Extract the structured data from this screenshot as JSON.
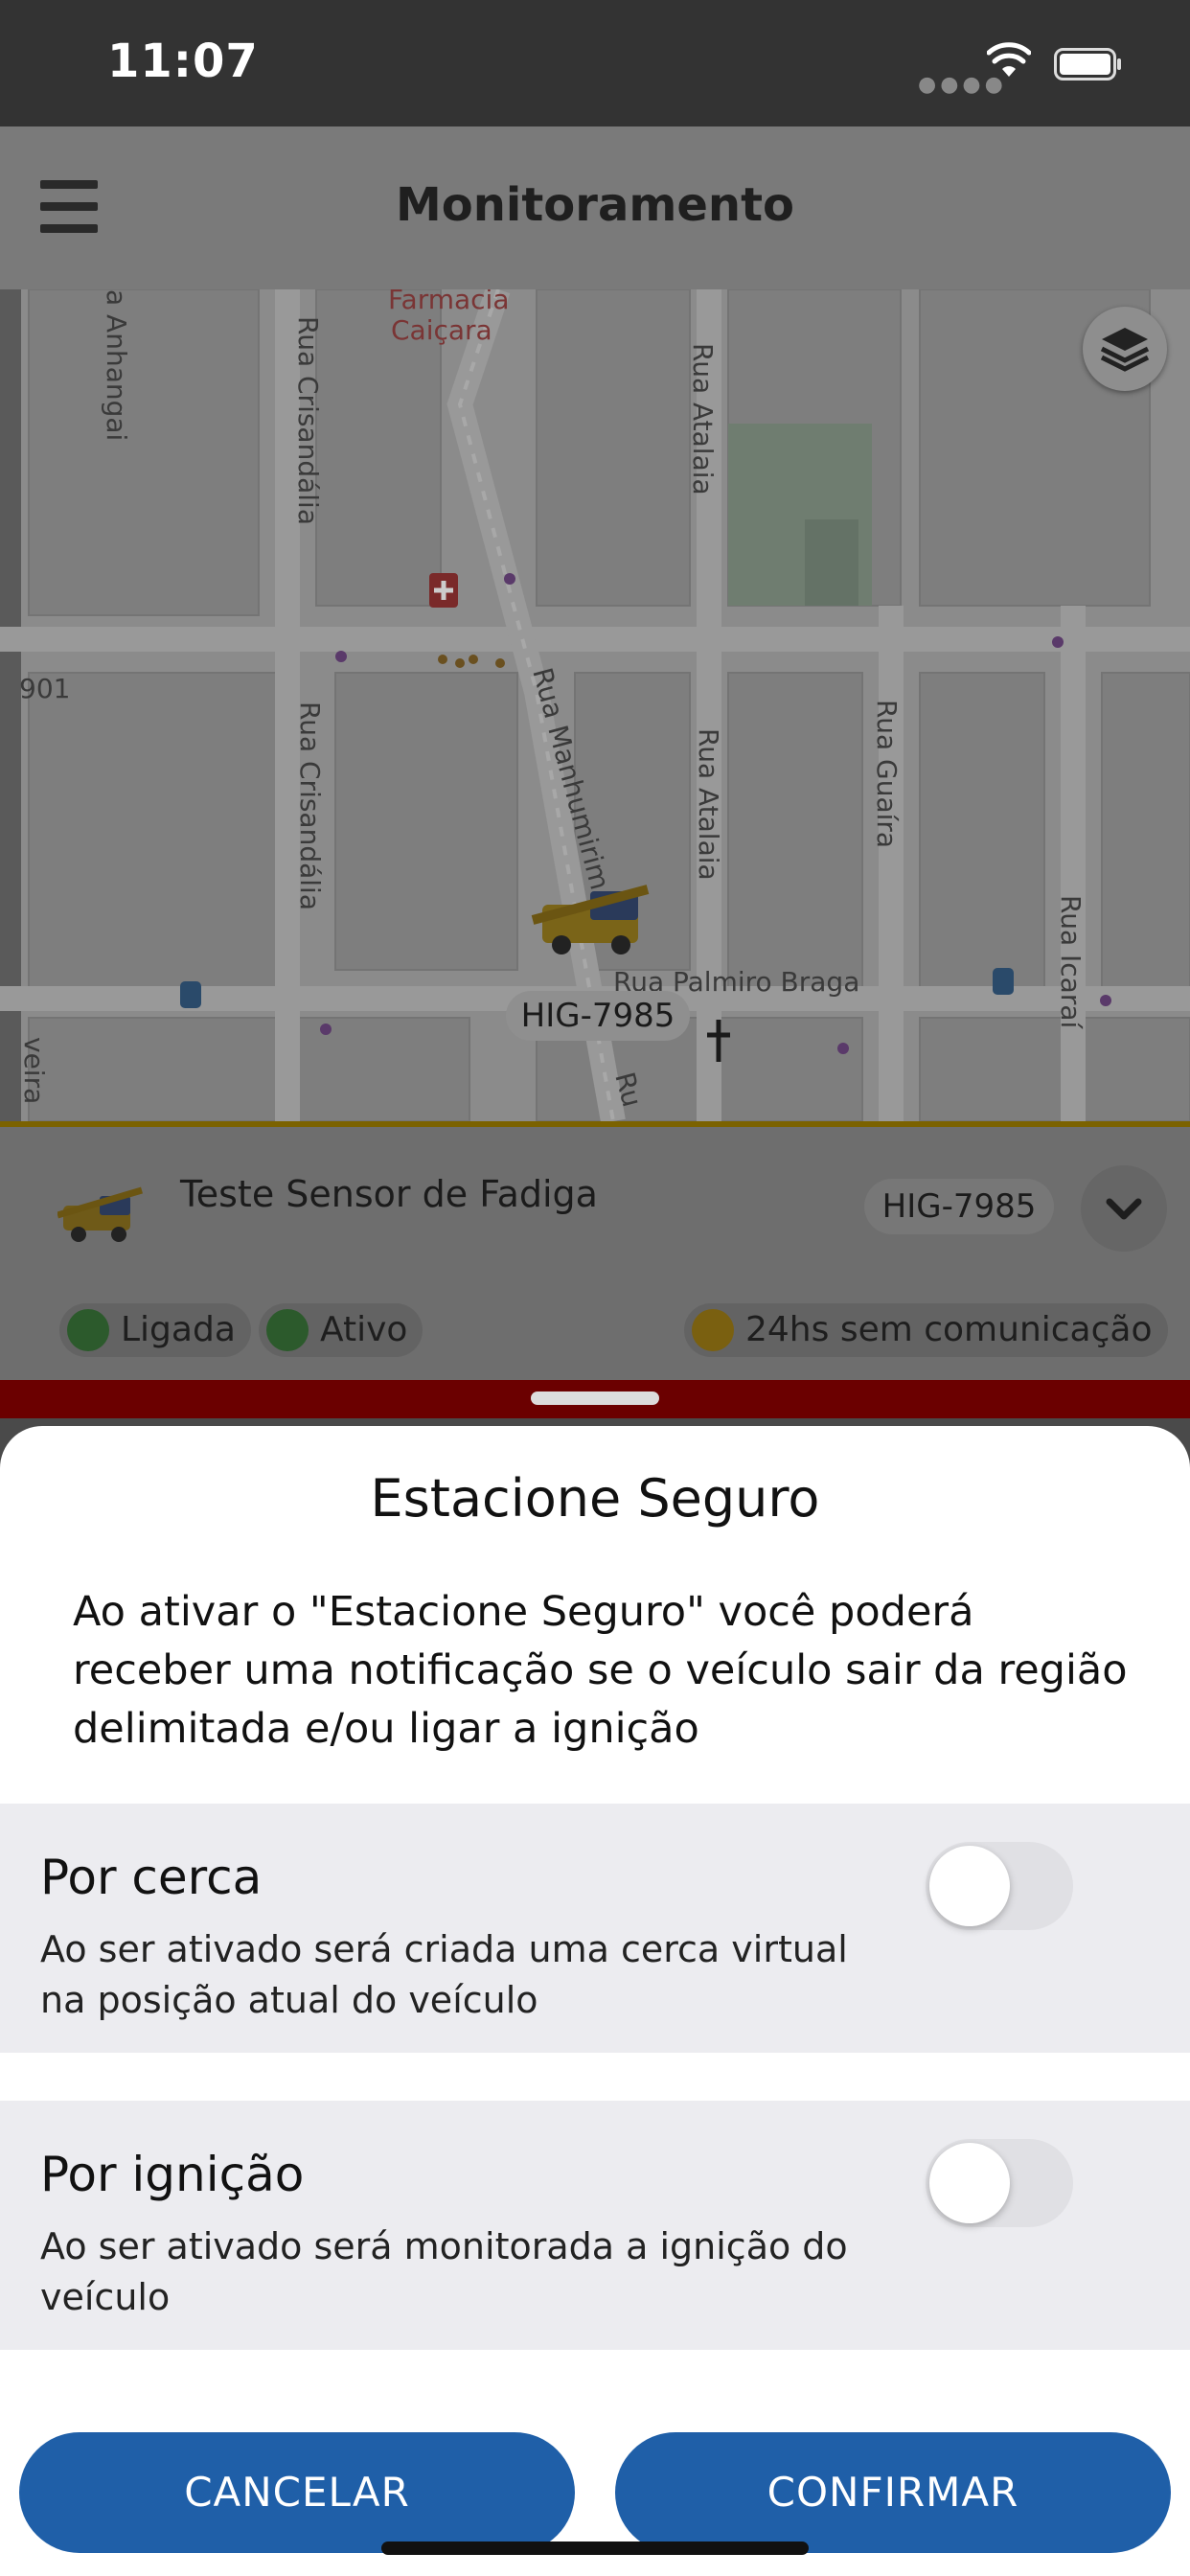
{
  "status_bar": {
    "time": "11:07"
  },
  "header": {
    "title": "Monitoramento"
  },
  "map": {
    "labels": {
      "farmacia": "Farmacia",
      "caicara": "Caiçara",
      "anhangai": "a Anhangai",
      "crisandalia_1": "Rua Crisandália",
      "crisandalia_2": "Rua Crisandália",
      "atalaia_1": "Rua Atalaia",
      "atalaia_2": "Rua Atalaia",
      "manhumirim": "Rua Manhumirim",
      "guaira": "Rua Guaíra",
      "icarai": "Rua Icaraí",
      "palmiro": "Rua Palmiro Braga",
      "num901": "901",
      "veira": "veira",
      "ru": "Ru"
    },
    "vehicle_plate": "HIG-7985"
  },
  "vehicle": {
    "name": "Teste Sensor de Fadiga",
    "plate": "HIG-7985",
    "chips": {
      "ignition": "Ligada",
      "status": "Ativo",
      "comm": "24hs sem comunicação"
    }
  },
  "sheet": {
    "title": "Estacione Seguro",
    "description": "Ao ativar o \"Estacione Seguro\" você poderá receber uma notificação se o veículo sair da região delimitada e/ou ligar a ignição",
    "options": [
      {
        "title": "Por cerca",
        "description": "Ao ser ativado será criada uma cerca virtual na posição atual do veículo",
        "enabled": false
      },
      {
        "title": "Por ignição",
        "description": "Ao ser ativado será monitorada a ignição do veículo",
        "enabled": false
      }
    ],
    "cancel_label": "CANCELAR",
    "confirm_label": "CONFIRMAR"
  },
  "colors": {
    "primary": "#1f5fa8",
    "header_dimmed": "#7a7a7a",
    "sheet_option_bg": "#ececf0"
  }
}
